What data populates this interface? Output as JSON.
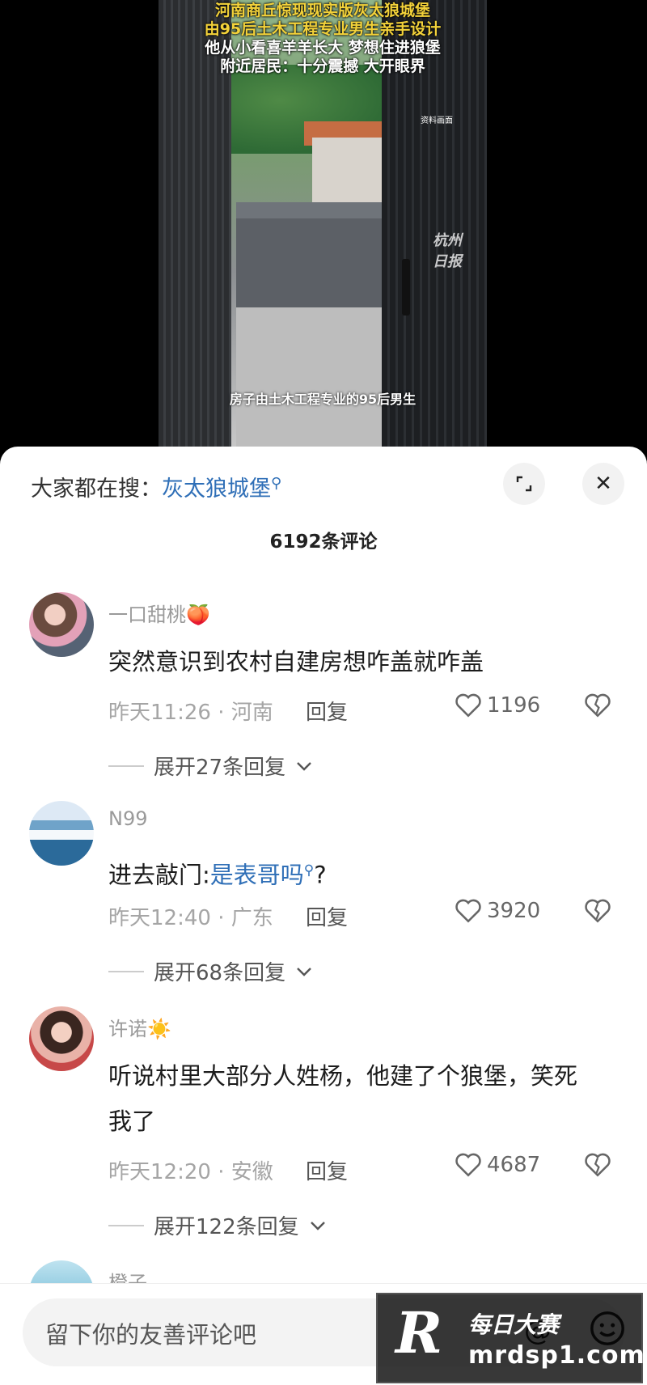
{
  "video": {
    "caption_lines": [
      {
        "text": "河南商丘惊现现实版灰太狼城堡",
        "color": "yellow"
      },
      {
        "text": "由95后土木工程专业男生亲手设计",
        "color": "yellow"
      },
      {
        "text": "他从小看喜羊羊长大 梦想住进狼堡",
        "color": "white"
      },
      {
        "text": "附近居民：十分震撼 大开眼界",
        "color": "white"
      }
    ],
    "source_tag": "资料画面",
    "watermark_line1": "杭州",
    "watermark_line2": "日报",
    "subtitle": "房子由土木工程专业的95后男生"
  },
  "sheet": {
    "search_prefix": "大家都在搜：",
    "search_keyword": "灰太狼城堡",
    "comment_count": "6192条评论",
    "comments": [
      {
        "username": "一口甜桃🍑",
        "text": "突然意识到农村自建房想咋盖就咋盖",
        "time_location": "昨天11:26 · 河南",
        "reply_label": "回复",
        "likes": "1196",
        "expand_label": "展开27条回复"
      },
      {
        "username": "N99",
        "text_prefix": "进去敲门:",
        "text_link": "是表哥吗",
        "text_suffix": "?",
        "time_location": "昨天12:40 · 广东",
        "reply_label": "回复",
        "likes": "3920",
        "expand_label": "展开68条回复"
      },
      {
        "username": "许诺☀️",
        "text": "听说村里大部分人姓杨，他建了个狼堡，笑死我了",
        "time_location": "昨天12:20 · 安徽",
        "reply_label": "回复",
        "likes": "4687",
        "expand_label": "展开122条回复"
      },
      {
        "username": "橙子"
      }
    ]
  },
  "input": {
    "placeholder": "留下你的友善评论吧"
  },
  "watermark_logo": {
    "letter": "R",
    "line1": "每日大赛",
    "line2": "mrdsp1.com"
  },
  "colors": {
    "link": "#2f6fb7",
    "caption_yellow": "#f3d23a"
  }
}
